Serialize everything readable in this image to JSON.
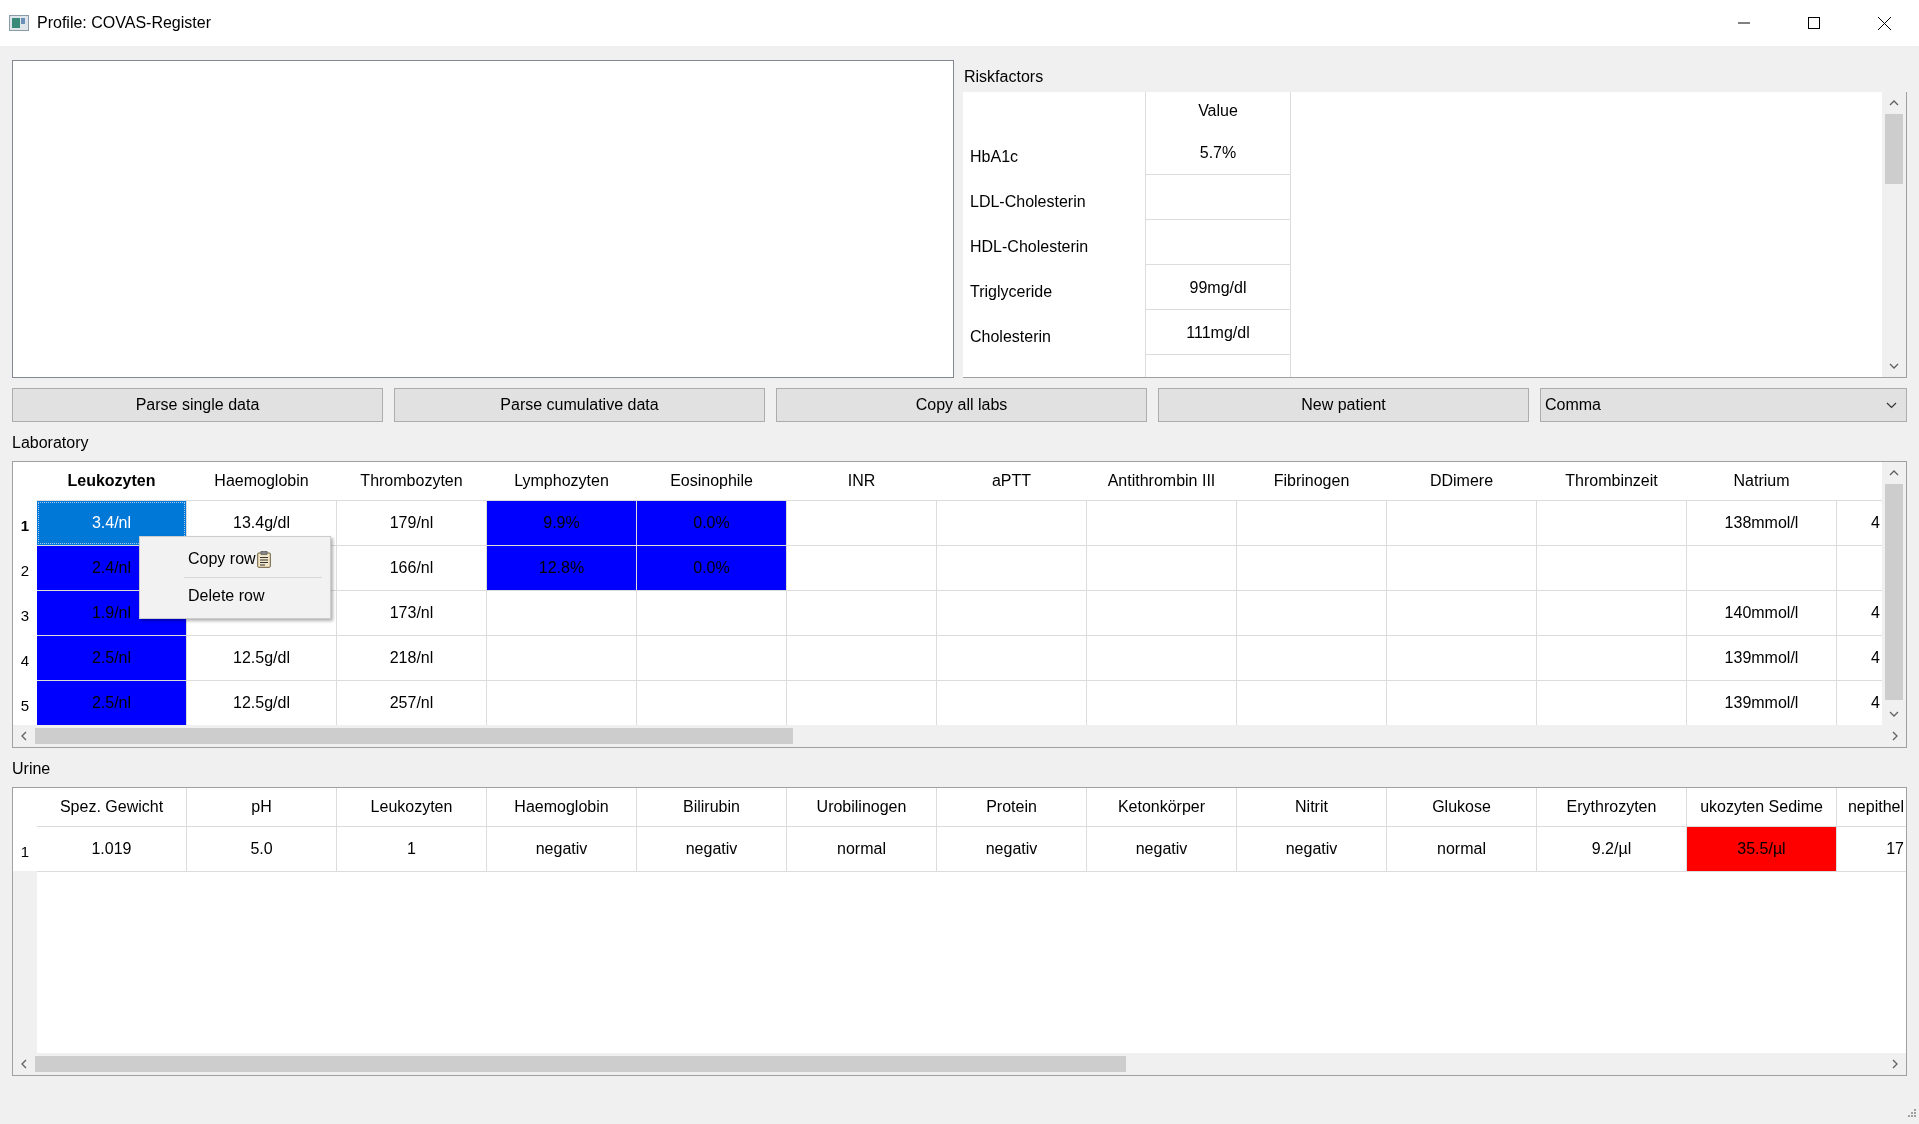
{
  "window": {
    "title": "Profile: COVAS-Register"
  },
  "riskfactors": {
    "label": "Riskfactors",
    "value_header": "Value",
    "rows": [
      {
        "name": "HbA1c",
        "value": "5.7%"
      },
      {
        "name": "LDL-Cholesterin"
      },
      {
        "name": "HDL-Cholesterin"
      },
      {
        "name": "Triglyceride",
        "value": "99mg/dl"
      },
      {
        "name": "Cholesterin",
        "value": "111mg/dl"
      }
    ]
  },
  "buttons": [
    "Parse single data",
    "Parse cumulative data",
    "Copy all labs",
    "New patient"
  ],
  "separator_select": {
    "value": "Comma"
  },
  "laboratory": {
    "label": "Laboratory",
    "columns": [
      "Leukozyten",
      "Haemoglobin",
      "Thrombozyten",
      "Lymphozyten",
      "Eosinophile",
      "INR",
      "aPTT",
      "Antithrombin III",
      "Fibrinogen",
      "DDimere",
      "Thrombinzeit",
      "Natrium"
    ],
    "rows": [
      {
        "number": "1",
        "cells": [
          {
            "text": "3.4/nl",
            "selected": true
          },
          {
            "text": "13.4g/dl",
            "selected": false
          },
          {
            "text": "179/nl",
            "selected": false
          },
          {
            "text": "9.9%",
            "color": "#0000ff",
            "selected": false
          },
          {
            "text": "0.0%",
            "color": "#0000ff",
            "selected": false
          },
          null,
          null,
          null,
          null,
          null,
          null,
          {
            "text": "138mmol/l",
            "selected": false
          },
          {
            "text": "4",
            "selected": false
          }
        ]
      },
      {
        "number": "2",
        "cells": [
          {
            "text": "2.4/nl",
            "color": "#0000ff",
            "selected": false
          },
          null,
          {
            "text": "166/nl",
            "selected": false
          },
          {
            "text": "12.8%",
            "color": "#0000ff",
            "selected": false
          },
          {
            "text": "0.0%",
            "color": "#0000ff",
            "selected": false
          },
          null,
          null,
          null,
          null,
          null,
          null,
          null,
          null
        ]
      },
      {
        "number": "3",
        "cells": [
          {
            "text": "1.9/nl",
            "color": "#0000ff",
            "selected": false
          },
          null,
          {
            "text": "173/nl",
            "selected": false
          },
          null,
          null,
          null,
          null,
          null,
          null,
          null,
          null,
          {
            "text": "140mmol/l",
            "selected": false
          },
          {
            "text": "4",
            "selected": false
          }
        ]
      },
      {
        "number": "4",
        "cells": [
          {
            "text": "2.5/nl",
            "color": "#0000ff",
            "selected": false
          },
          {
            "text": "12.5g/dl",
            "selected": false
          },
          {
            "text": "218/nl",
            "selected": false
          },
          null,
          null,
          null,
          null,
          null,
          null,
          null,
          null,
          {
            "text": "139mmol/l",
            "selected": false
          },
          {
            "text": "4",
            "selected": false
          }
        ]
      },
      {
        "number": "5",
        "cells": [
          {
            "text": "2.5/nl",
            "color": "#0000ff",
            "selected": false
          },
          {
            "text": "12.5g/dl",
            "selected": false
          },
          {
            "text": "257/nl",
            "selected": false
          },
          null,
          null,
          null,
          null,
          null,
          null,
          null,
          null,
          {
            "text": "139mmol/l",
            "selected": false
          },
          {
            "text": "4",
            "selected": false
          }
        ]
      }
    ]
  },
  "context_menu": {
    "items": [
      {
        "kind": "item",
        "label": "Copy row",
        "icon": true
      },
      {
        "kind": "separator"
      },
      {
        "kind": "item",
        "label": "Delete row",
        "icon": false
      }
    ]
  },
  "urine": {
    "label": "Urine",
    "columns": [
      "Spez. Gewicht",
      "pH",
      "Leukozyten",
      "Haemoglobin",
      "Bilirubin",
      "Urobilinogen",
      "Protein",
      "Ketonkörper",
      "Nitrit",
      "Glukose",
      "Erythrozyten",
      "ukozyten Sedime",
      "nepithel"
    ],
    "rows": [
      {
        "number": "1",
        "cells": [
          {
            "text": "1.019"
          },
          {
            "text": "5.0"
          },
          {
            "text": "1"
          },
          {
            "text": "negativ"
          },
          {
            "text": "negativ"
          },
          {
            "text": "normal"
          },
          {
            "text": "negativ"
          },
          {
            "text": "negativ"
          },
          {
            "text": "negativ"
          },
          {
            "text": "normal"
          },
          {
            "text": "9.2/µl"
          },
          {
            "text": "35.5/µl",
            "color": "#ff0000"
          },
          {
            "text": "17"
          }
        ]
      }
    ]
  }
}
